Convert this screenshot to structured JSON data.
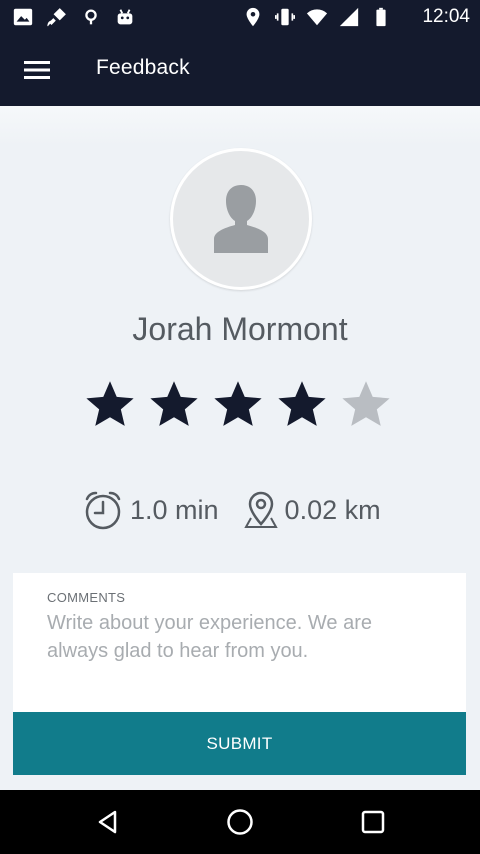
{
  "status_bar": {
    "time": "12:04",
    "left_icons": [
      "photo-icon",
      "satellite-icon",
      "location-dot-icon",
      "android-icon"
    ],
    "right_icons": [
      "location-pin-icon",
      "vibrate-icon",
      "wifi-icon",
      "signal-icon",
      "battery-icon"
    ]
  },
  "toolbar": {
    "title": "Feedback",
    "menu_icon": "hamburger-menu-icon"
  },
  "driver": {
    "name": "Jorah Mormont",
    "avatar_icon": "person-silhouette-icon"
  },
  "rating": {
    "value": 4,
    "max": 5,
    "filled_color": "#141a2d",
    "empty_color": "#b9bdc2"
  },
  "trip": {
    "duration": "1.0 min",
    "duration_icon": "alarm-clock-icon",
    "distance": "0.02 km",
    "distance_icon": "map-pin-icon"
  },
  "comments": {
    "label": "COMMENTS",
    "placeholder": "Write about your experience. We are always glad to hear from you.",
    "value": ""
  },
  "submit": {
    "label": "SUBMIT",
    "color": "#117c8b"
  },
  "nav": {
    "buttons": [
      "back-icon",
      "home-icon",
      "recents-icon"
    ]
  },
  "colors": {
    "app_bar": "#141a2d",
    "background": "#eef2f6"
  }
}
